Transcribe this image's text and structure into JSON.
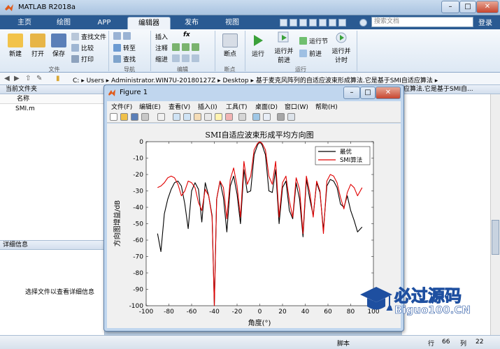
{
  "app": {
    "title": "MATLAB R2018a",
    "search_placeholder": "搜索文档",
    "signin": "登录"
  },
  "tabs": [
    {
      "label": "主页"
    },
    {
      "label": "绘图"
    },
    {
      "label": "APP"
    },
    {
      "label": "编辑器",
      "active": true
    },
    {
      "label": "发布"
    },
    {
      "label": "视图"
    }
  ],
  "ribbon": {
    "file": {
      "new": "新建",
      "open": "打开",
      "save": "保存",
      "find_files": "查找文件",
      "compare": "比较",
      "print": "打印",
      "group": "文件"
    },
    "navigate": {
      "goto": "转至",
      "find": "查找",
      "group": "导航"
    },
    "edit": {
      "insert": "插入",
      "comment": "注释",
      "indent": "缩进",
      "fx": "fx",
      "group": "编辑"
    },
    "breakpoints": {
      "label": "断点",
      "group": "断点"
    },
    "run": {
      "run": "运行",
      "run_advance_l1": "运行并",
      "run_advance_l2": "前进",
      "run_section": "运行节",
      "advance": "前进",
      "run_time_l1": "运行并",
      "run_time_l2": "计时",
      "group": "运行"
    }
  },
  "address": {
    "drive": "C:",
    "parts": [
      "Users",
      "Administrator.WIN7U-20180127Z",
      "Desktop",
      "基于麦克风阵列的自适应波束形成算法.它是基于SMI自适应算法"
    ]
  },
  "current_folder": {
    "title": "当前文件夹",
    "column": "名称",
    "files": [
      "SMI.m"
    ]
  },
  "details": {
    "title": "详细信息",
    "message": "选择文件以查看详细信息"
  },
  "right_panel": {
    "header": "应算法.它是基于SMI自..."
  },
  "status": {
    "mode": "脚本",
    "row_label": "行",
    "row": "66",
    "col_label": "列",
    "col": "22"
  },
  "figure": {
    "title": "Figure 1",
    "menu": [
      "文件(F)",
      "编辑(E)",
      "查看(V)",
      "插入(I)",
      "工具(T)",
      "桌面(D)",
      "窗口(W)",
      "帮助(H)"
    ]
  },
  "chart_data": {
    "type": "line",
    "title": "SMI自适应波束形成平均方向图",
    "xlabel": "角度(°)",
    "ylabel": "方向图增益/dB",
    "xlim": [
      -100,
      100
    ],
    "ylim": [
      -100,
      0
    ],
    "xticks": [
      -100,
      -80,
      -60,
      -40,
      -20,
      0,
      20,
      40,
      60,
      80,
      100
    ],
    "yticks": [
      0,
      -10,
      -20,
      -30,
      -40,
      -50,
      -60,
      -70,
      -80,
      -90,
      -100
    ],
    "grid": false,
    "legend_position": "top-right",
    "series": [
      {
        "name": "最优",
        "color": "#000000",
        "x": [
          -90,
          -87,
          -84,
          -81,
          -78,
          -75,
          -72,
          -69,
          -66,
          -63,
          -60,
          -57,
          -54,
          -51,
          -48,
          -45,
          -42,
          -40,
          -38,
          -35,
          -32,
          -29,
          -26,
          -23,
          -20,
          -17,
          -14,
          -11,
          -8,
          -5,
          -2,
          0,
          2,
          5,
          8,
          11,
          14,
          17,
          20,
          23,
          26,
          29,
          32,
          35,
          38,
          41,
          44,
          47,
          50,
          53,
          56,
          59,
          62,
          65,
          68,
          71,
          74,
          77,
          80,
          83,
          86,
          90
        ],
        "y": [
          -56,
          -67,
          -44,
          -35,
          -29,
          -25,
          -24,
          -27,
          -38,
          -53,
          -30,
          -25,
          -29,
          -49,
          -25,
          -33,
          -45,
          -100,
          -35,
          -24,
          -34,
          -55,
          -27,
          -21,
          -32,
          -50,
          -17,
          -31,
          -30,
          -8,
          -2,
          0,
          -2,
          -8,
          -30,
          -31,
          -17,
          -50,
          -28,
          -24,
          -42,
          -47,
          -25,
          -35,
          -58,
          -23,
          -35,
          -45,
          -25,
          -31,
          -54,
          -27,
          -23,
          -24,
          -28,
          -38,
          -40,
          -33,
          -42,
          -48,
          -55,
          -52
        ]
      },
      {
        "name": "SMI算法",
        "color": "#e00000",
        "x": [
          -90,
          -87,
          -84,
          -81,
          -78,
          -75,
          -72,
          -69,
          -66,
          -63,
          -60,
          -57,
          -54,
          -51,
          -48,
          -45,
          -42,
          -40,
          -38,
          -35,
          -32,
          -29,
          -26,
          -23,
          -20,
          -17,
          -14,
          -11,
          -8,
          -5,
          -2,
          0,
          2,
          5,
          8,
          11,
          14,
          17,
          20,
          23,
          26,
          29,
          32,
          35,
          38,
          41,
          44,
          47,
          50,
          53,
          56,
          59,
          62,
          65,
          68,
          71,
          74,
          77,
          80,
          83,
          86,
          90
        ],
        "y": [
          -28,
          -27,
          -25,
          -22,
          -21,
          -22,
          -26,
          -33,
          -30,
          -24,
          -25,
          -28,
          -37,
          -42,
          -29,
          -33,
          -46,
          -100,
          -35,
          -24,
          -28,
          -47,
          -23,
          -16,
          -27,
          -46,
          -12,
          -26,
          -21,
          -5,
          -1,
          0,
          -1,
          -5,
          -21,
          -26,
          -12,
          -46,
          -25,
          -21,
          -36,
          -46,
          -22,
          -29,
          -56,
          -21,
          -31,
          -46,
          -24,
          -30,
          -56,
          -24,
          -20,
          -21,
          -25,
          -34,
          -41,
          -31,
          -26,
          -28,
          -33,
          -28
        ]
      }
    ]
  },
  "watermark": {
    "cn": "必过源码",
    "en": "Biguo100.CN"
  },
  "colors": {
    "tab_bar": "#2a5a92",
    "optimal": "#000000",
    "smi": "#e00000",
    "watermark": "#1e4fa0"
  }
}
